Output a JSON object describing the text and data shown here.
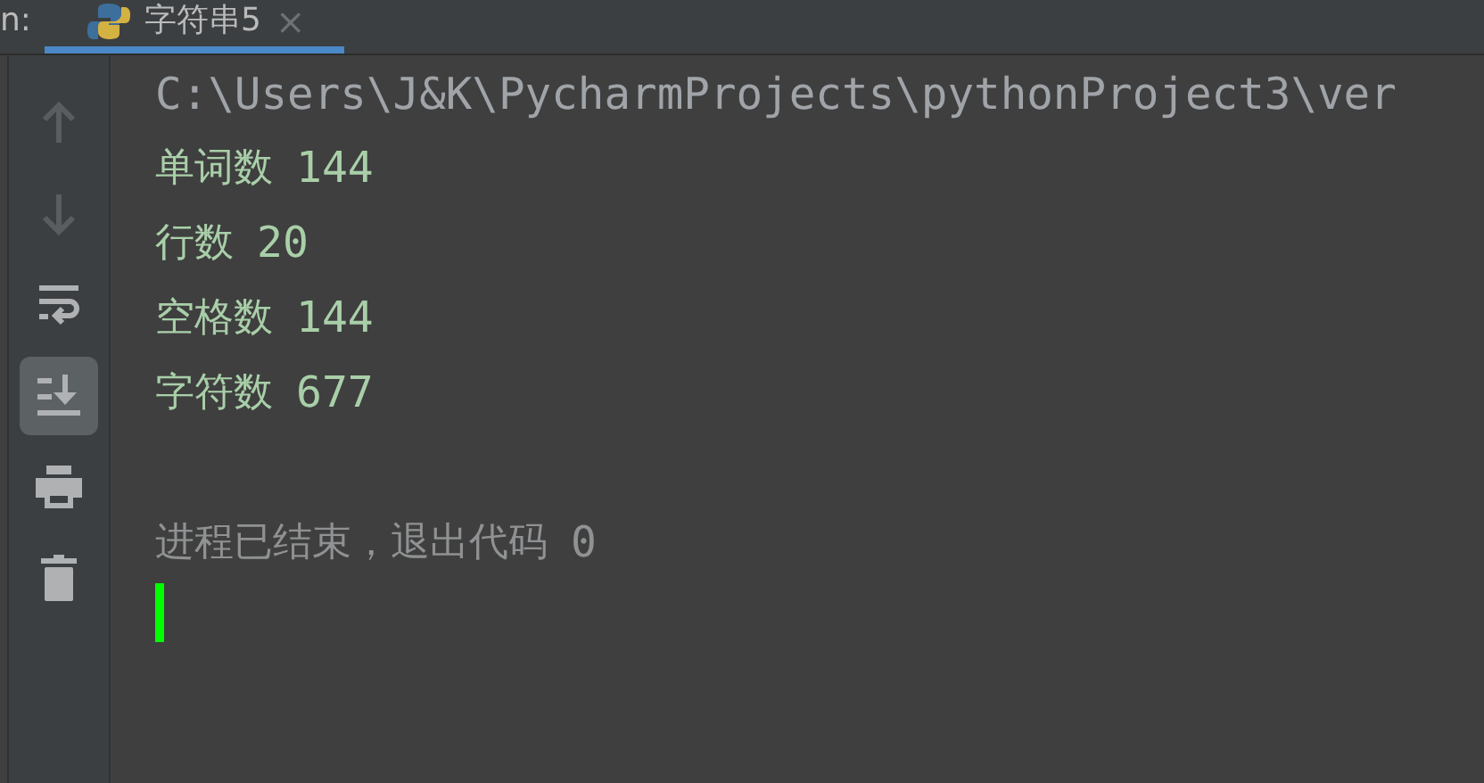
{
  "tab_bar": {
    "cut_label": "n:",
    "tabs": [
      {
        "label": "字符串5",
        "selected": true
      }
    ],
    "close": "×"
  },
  "toolbar": [
    {
      "kind": "up",
      "disabled": true,
      "selected": false
    },
    {
      "kind": "down",
      "disabled": true,
      "selected": false
    },
    {
      "kind": "wrap",
      "disabled": false,
      "selected": false
    },
    {
      "kind": "scroll",
      "disabled": false,
      "selected": true
    },
    {
      "kind": "print",
      "disabled": false,
      "selected": false
    },
    {
      "kind": "delete",
      "disabled": false,
      "selected": false
    }
  ],
  "console": {
    "lines": [
      {
        "kind": "command",
        "text": "C:\\Users\\J&K\\PycharmProjects\\pythonProject3\\ver"
      },
      {
        "kind": "output",
        "label": "单词数",
        "value": "144"
      },
      {
        "kind": "output",
        "label": "行数",
        "value": "20"
      },
      {
        "kind": "output",
        "label": "空格数",
        "value": "144"
      },
      {
        "kind": "output",
        "label": "字符数",
        "value": "677"
      },
      {
        "kind": "blank"
      },
      {
        "kind": "exit",
        "label": "进程已结束，退出代码",
        "value": "0"
      }
    ],
    "cursor": true
  }
}
